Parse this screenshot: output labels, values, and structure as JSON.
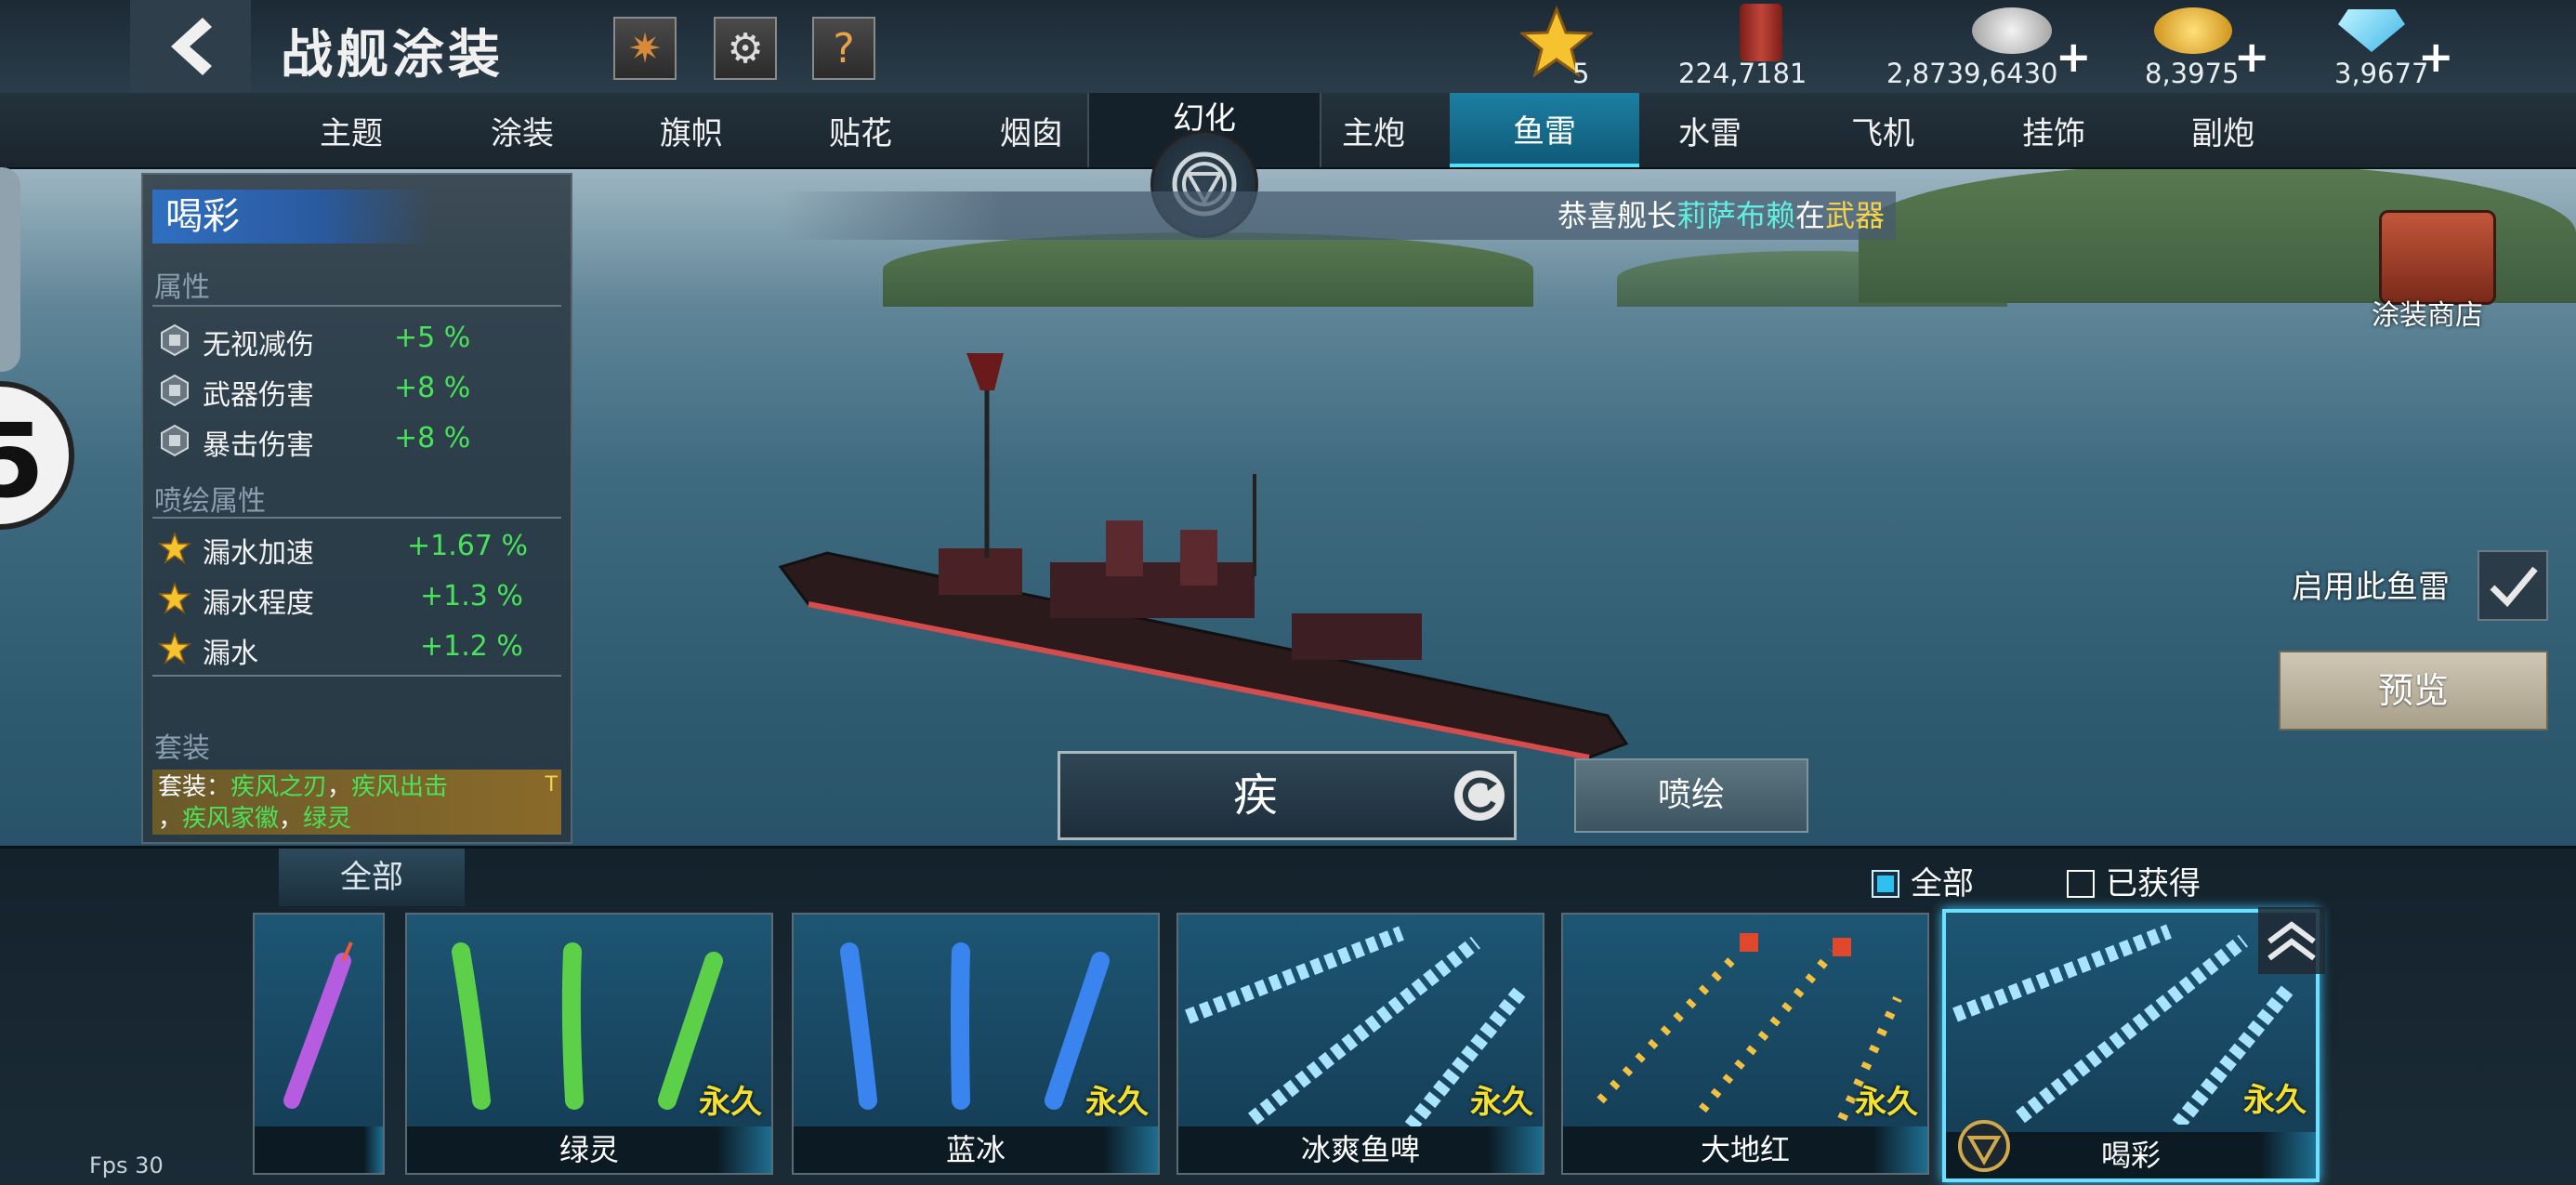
{
  "header": {
    "title": "战舰涂装",
    "help_label": "?"
  },
  "resources": {
    "stars": "5",
    "paint": "224,7181",
    "silver": "2,8739,6430",
    "gold": "8,3975",
    "diamond": "3,9677",
    "plus": "+"
  },
  "tabs": [
    "主题",
    "涂装",
    "旗帜",
    "贴花",
    "烟囱",
    "幻化",
    "主炮",
    "鱼雷",
    "水雷",
    "飞机",
    "挂饰",
    "副炮"
  ],
  "active_tab": "鱼雷",
  "panel": {
    "name": "喝彩",
    "attr_header": "属性",
    "attrs": [
      {
        "name": "无视减伤",
        "value": "+5 %"
      },
      {
        "name": "武器伤害",
        "value": "+8 %"
      },
      {
        "name": "暴击伤害",
        "value": "+8 %"
      }
    ],
    "spray_header": "喷绘属性",
    "spray_attrs": [
      {
        "name": "漏水加速",
        "value": "+1.67 %"
      },
      {
        "name": "漏水程度",
        "value": "+1.3 %"
      },
      {
        "name": "漏水",
        "value": "+1.2 %"
      }
    ],
    "set_header": "套装",
    "set_prefix": "套装：",
    "set_items": [
      "疾风之刃",
      "疾风出击",
      "疾风家徽",
      "绿灵"
    ],
    "set_sep": "，",
    "set_badge": "T"
  },
  "side_badge": "5",
  "notice": {
    "prefix": "恭喜舰长",
    "name": "莉萨布赖",
    "mid": "在",
    "item": "武器"
  },
  "store_label": "涂装商店",
  "enable_label": "启用此鱼雷",
  "preview_label": "预览",
  "selector_name": "疾",
  "spray_label": "喷绘",
  "bottom": {
    "all_tab": "全部",
    "filter_all": "全部",
    "filter_owned": "已获得"
  },
  "cards": [
    {
      "name": "",
      "perm": "",
      "theme": "purple"
    },
    {
      "name": "绿灵",
      "perm": "永久",
      "theme": "green"
    },
    {
      "name": "蓝冰",
      "perm": "永久",
      "theme": "blue"
    },
    {
      "name": "冰爽鱼啤",
      "perm": "永久",
      "theme": "ice"
    },
    {
      "name": "大地红",
      "perm": "永久",
      "theme": "gold"
    },
    {
      "name": "喝彩",
      "perm": "永久",
      "theme": "ice"
    }
  ],
  "fps": "Fps 30",
  "colors": {
    "accent": "#1c7fa2",
    "green_value": "#49e35b",
    "gold_text": "#f7e02a"
  }
}
